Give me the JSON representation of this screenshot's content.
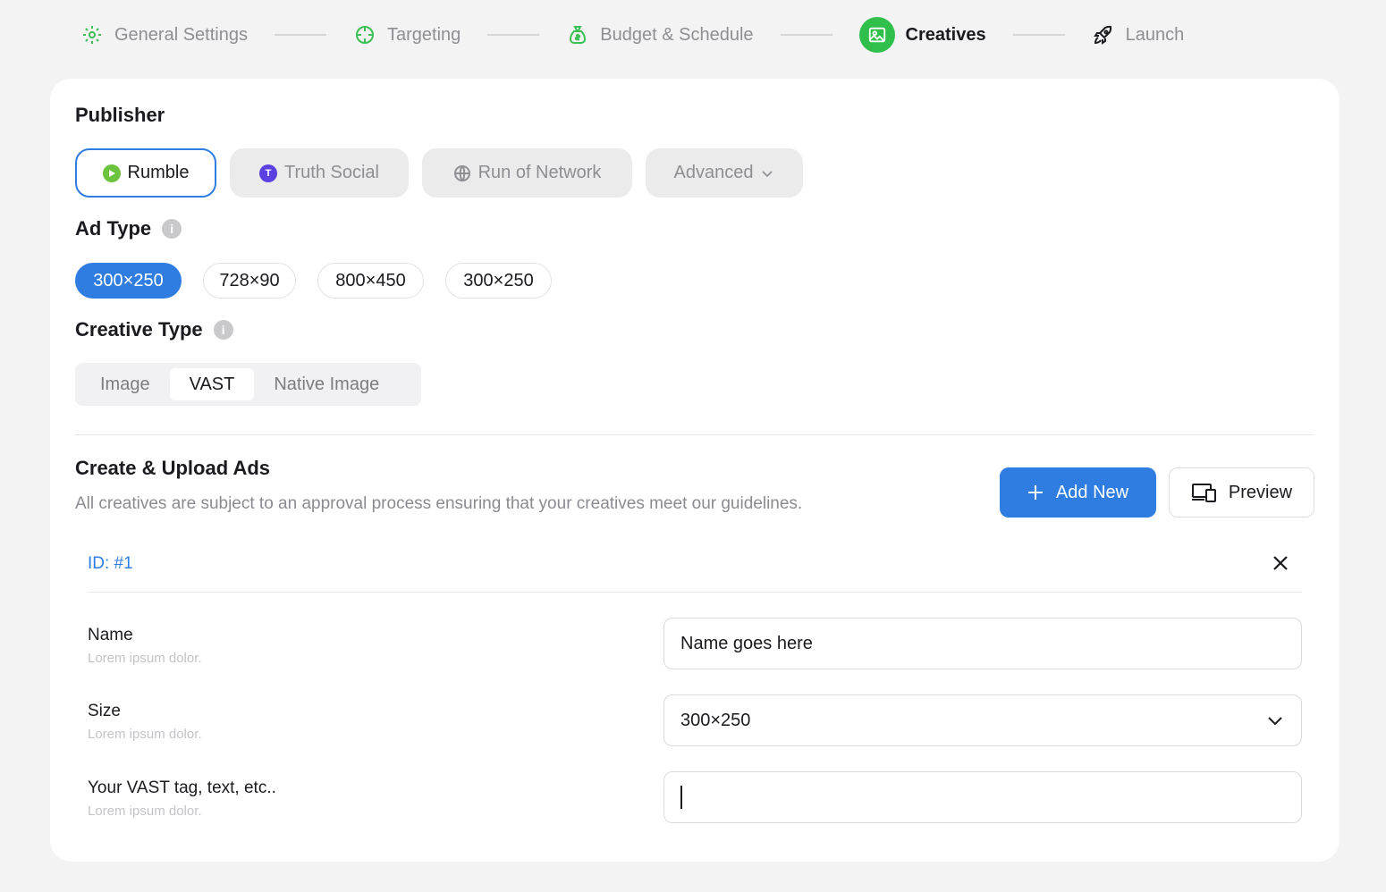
{
  "stepper": {
    "steps": [
      {
        "label": "General Settings",
        "icon": "gear-icon"
      },
      {
        "label": "Targeting",
        "icon": "crosshair-icon"
      },
      {
        "label": "Budget & Schedule",
        "icon": "money-bag-icon"
      },
      {
        "label": "Creatives",
        "icon": "image-icon",
        "active": true
      },
      {
        "label": "Launch",
        "icon": "rocket-icon"
      }
    ]
  },
  "publisher": {
    "title": "Publisher",
    "options": [
      {
        "label": "Rumble",
        "selected": true
      },
      {
        "label": "Truth Social"
      },
      {
        "label": "Run of Network"
      },
      {
        "label": "Advanced"
      }
    ]
  },
  "ad_type": {
    "title": "Ad Type",
    "info": "i",
    "sizes": [
      "300×250",
      "728×90",
      "800×450",
      "300×250"
    ],
    "selected_index": 0
  },
  "creative_type": {
    "title": "Creative Type",
    "info": "i",
    "options": [
      "Image",
      "VAST",
      "Native Image"
    ],
    "selected": "VAST"
  },
  "upload": {
    "title": "Create & Upload Ads",
    "description": "All creatives are subject to an approval process ensuring that your creatives meet our guidelines.",
    "add_label": "Add New",
    "preview_label": "Preview"
  },
  "ad": {
    "id_label": "ID: #1",
    "fields": [
      {
        "label": "Name",
        "hint": "Lorem ipsum dolor.",
        "value": "Name goes here"
      },
      {
        "label": "Size",
        "hint": "Lorem ipsum dolor.",
        "value": "300×250"
      },
      {
        "label": "Your VAST tag, text, etc..",
        "hint": "Lorem ipsum dolor.",
        "value": ""
      }
    ]
  },
  "colors": {
    "accent": "#2f7de1",
    "active_step": "#2fbf4a",
    "step_icon": "#3cbf55",
    "rumble": "#6bc43c",
    "truth_social": "#5b3fe0"
  }
}
